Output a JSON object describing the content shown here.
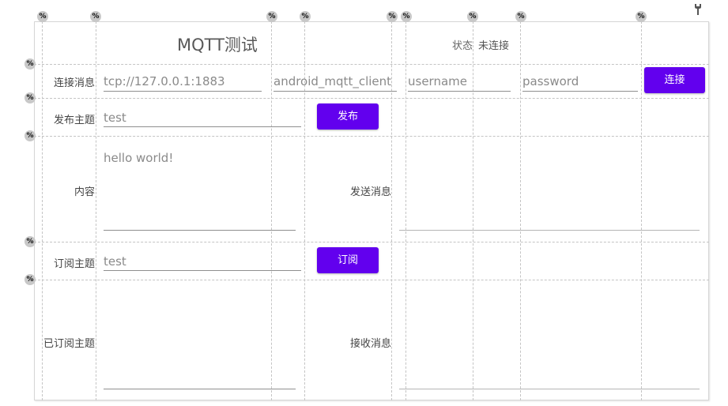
{
  "title": "MQTT测试",
  "status": {
    "label": "状态",
    "value": "未连接"
  },
  "connect_row": {
    "label": "连接消息",
    "server": "tcp://127.0.0.1:1883",
    "client_id": "android_mqtt_client",
    "username_placeholder": "username",
    "password_placeholder": "password",
    "button": "连接"
  },
  "publish_row": {
    "label": "发布主题",
    "topic": "test",
    "button": "发布"
  },
  "content_row": {
    "label": "内容",
    "content": "hello world!",
    "send_label": "发送消息"
  },
  "subscribe_row": {
    "label": "订阅主题",
    "topic": "test",
    "button": "订阅"
  },
  "subscribed_row": {
    "label": "已订阅主题",
    "receive_label": "接收消息"
  },
  "markers": {
    "percent": "%"
  },
  "colors": {
    "accent": "#6200ee",
    "guide": "#c4c4c4",
    "text": "#444444",
    "hint": "#8a8a8a"
  },
  "icons": {
    "top_right": "wrench-icon"
  }
}
